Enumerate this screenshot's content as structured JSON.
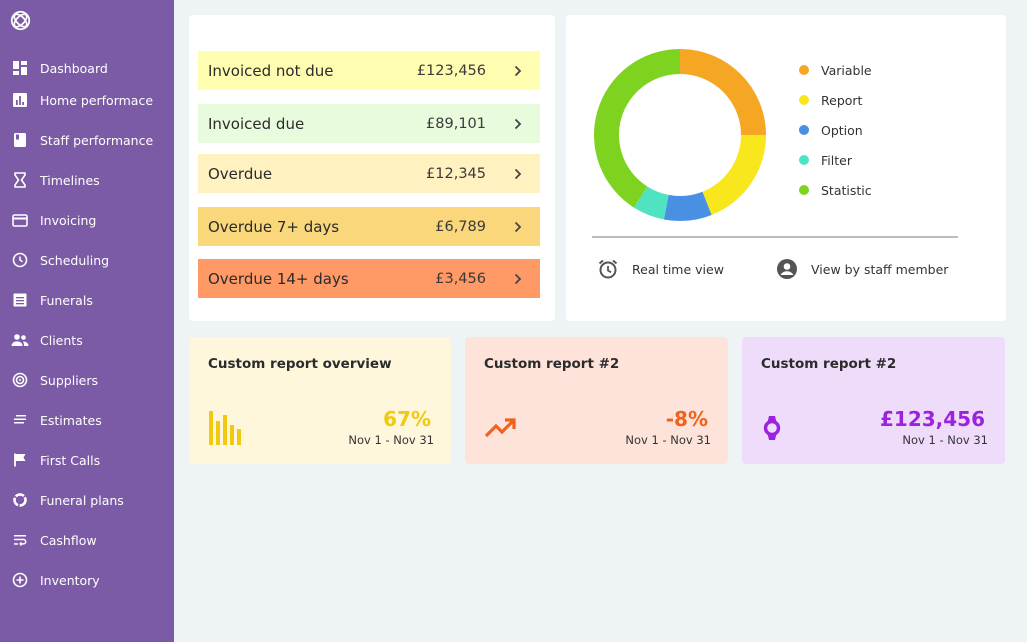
{
  "sidebar": {
    "logo": "logo-icon",
    "bg_color": "#7c5ba6",
    "items": [
      {
        "label": "Dashboard",
        "icon": "dashboard-icon"
      },
      {
        "label": "Home performace",
        "icon": "bar-chart-icon"
      },
      {
        "label": "Staff performance",
        "icon": "book-icon"
      },
      {
        "label": "Timelines",
        "icon": "hourglass-icon"
      },
      {
        "label": "Invoicing",
        "icon": "credit-card-icon"
      },
      {
        "label": "Scheduling",
        "icon": "clock-icon"
      },
      {
        "label": "Funerals",
        "icon": "list-icon"
      },
      {
        "label": "Clients",
        "icon": "people-icon"
      },
      {
        "label": "Suppliers",
        "icon": "target-icon"
      },
      {
        "label": "Estimates",
        "icon": "notes-icon"
      },
      {
        "label": "First Calls",
        "icon": "flag-icon"
      },
      {
        "label": "Funeral plans",
        "icon": "donut-icon"
      },
      {
        "label": "Cashflow",
        "icon": "wrap-text-icon"
      },
      {
        "label": "Inventory",
        "icon": "add-circle-icon"
      }
    ]
  },
  "invoices": [
    {
      "label": "Invoiced not due",
      "amount": "£123,456",
      "color": "#fffdb0"
    },
    {
      "label": "Invoiced due",
      "amount": "£89,101",
      "color": "#e8fbdc"
    },
    {
      "label": "Overdue",
      "amount": "£12,345",
      "color": "#fff1c0"
    },
    {
      "label": "Overdue 7+ days",
      "amount": "£6,789",
      "color": "#f9d77a"
    },
    {
      "label": "Overdue 14+ days",
      "amount": "£3,456",
      "color": "#ff9965"
    }
  ],
  "chart_data": {
    "type": "pie",
    "donut": true,
    "series": [
      {
        "name": "Variable",
        "value": 25,
        "color": "#f5a623"
      },
      {
        "name": "Report",
        "value": 19,
        "color": "#f8e71c"
      },
      {
        "name": "Option",
        "value": 9,
        "color": "#4a90e2"
      },
      {
        "name": "Filter",
        "value": 6,
        "color": "#50e3c2"
      },
      {
        "name": "Statistic",
        "value": 41,
        "color": "#7ed321"
      }
    ]
  },
  "chart_actions": {
    "realtime_label": "Real time view",
    "realtime_icon": "alarm-clock-icon",
    "staff_label": "View by staff member",
    "staff_icon": "account-circle-icon"
  },
  "reports": [
    {
      "title": "Custom report overview",
      "value": "67%",
      "range": "Nov 1 - Nov 31",
      "bg": "#fff7dc",
      "accent": "#f2c811",
      "icon": "bars-icon"
    },
    {
      "title": "Custom report #2",
      "value": "-8%",
      "range": "Nov 1 - Nov 31",
      "bg": "#fde3d9",
      "accent": "#f2621c",
      "icon": "trending-up-icon"
    },
    {
      "title": "Custom report #2",
      "value": "£123,456",
      "range": "Nov 1 - Nov 31",
      "bg": "#efdcfb",
      "accent": "#9b22e0",
      "icon": "watch-icon"
    }
  ]
}
